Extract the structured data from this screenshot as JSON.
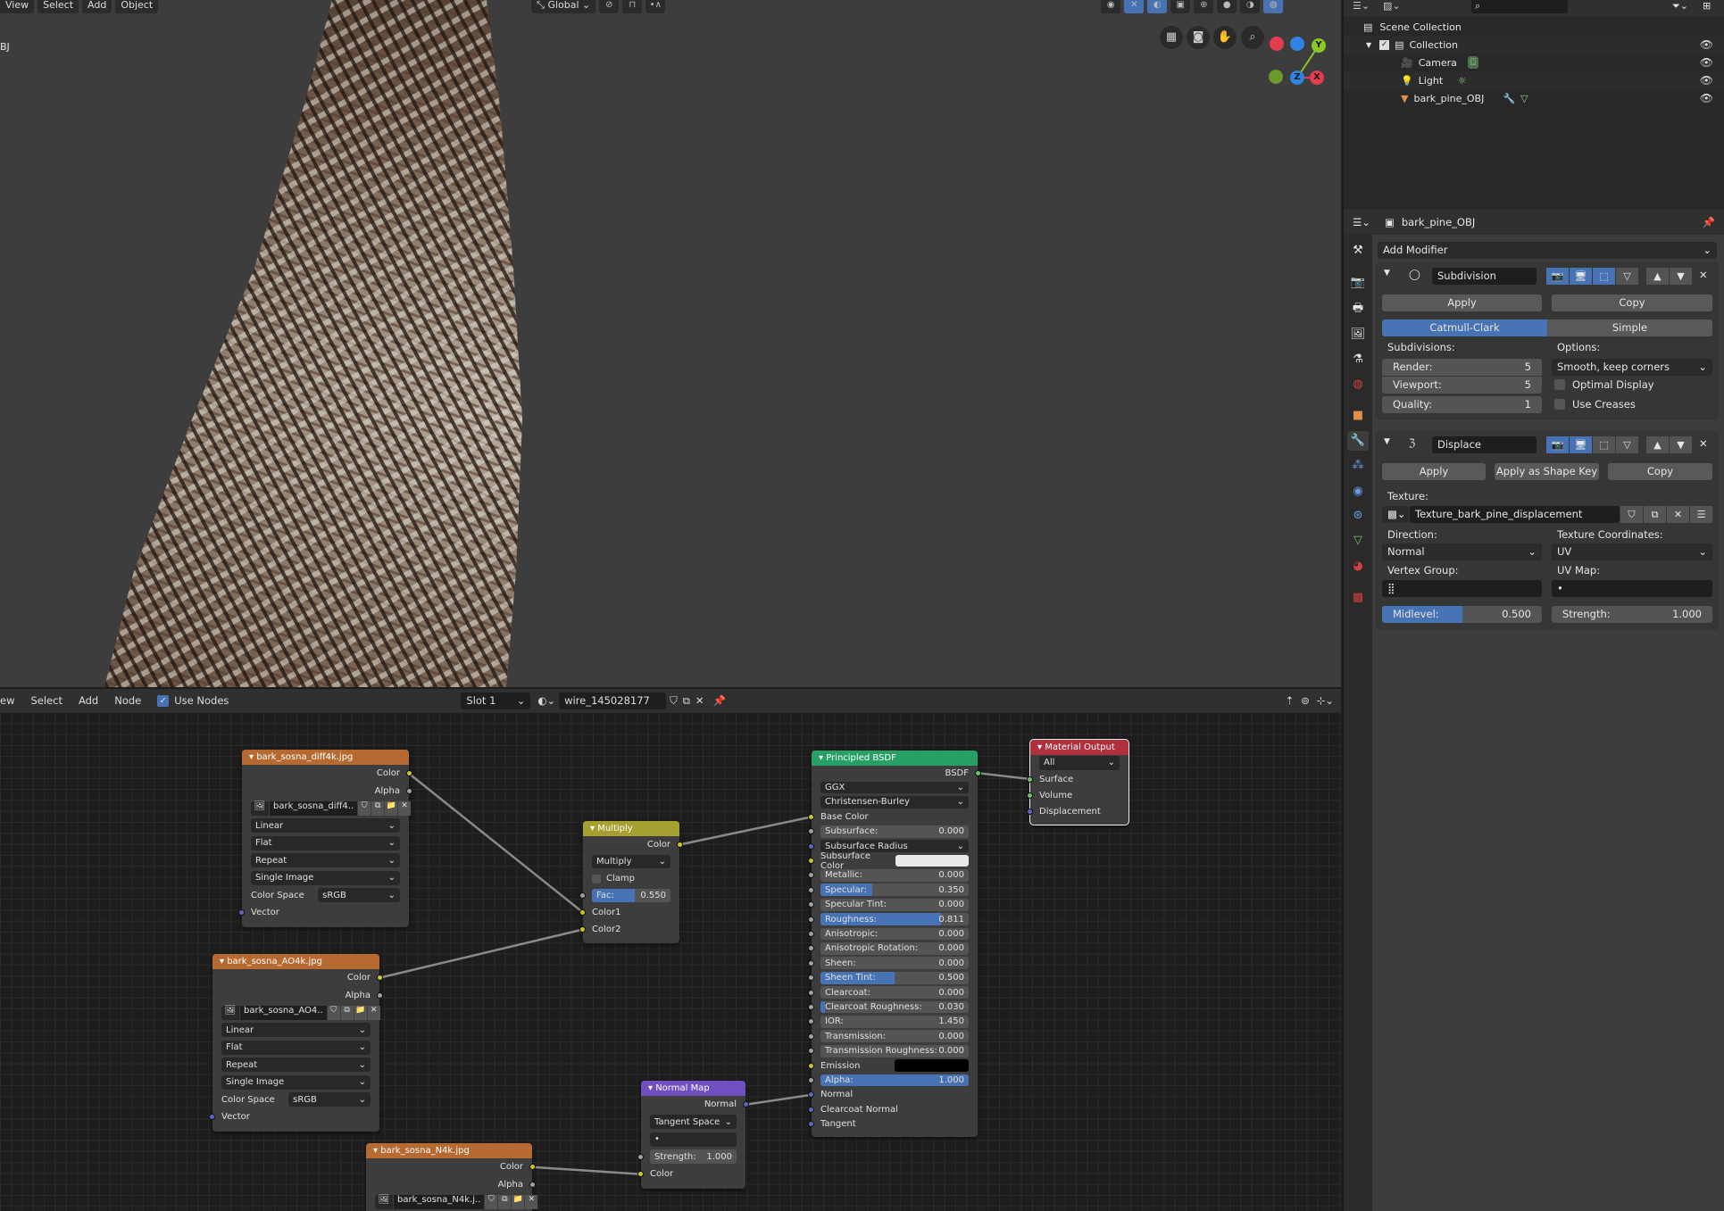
{
  "viewport": {
    "menus": [
      "View",
      "Select",
      "Add",
      "Object"
    ],
    "orientation": "Global",
    "object_label_fragment": "BJ",
    "nav_icons": [
      "grid-icon",
      "camera-icon",
      "hand-icon",
      "zoom-icon"
    ],
    "axes": {
      "x": "X",
      "y": "Y",
      "z": "Z"
    },
    "colors": {
      "x": "#e53d4f",
      "y": "#8bc727",
      "z": "#2f83e3"
    }
  },
  "node_editor": {
    "menus": [
      "ew",
      "Select",
      "Add",
      "Node"
    ],
    "use_nodes_label": "Use Nodes",
    "use_nodes": true,
    "slot": "Slot 1",
    "material": "wire_145028177"
  },
  "nodes": [
    {
      "id": "diff",
      "title": "bark_sosna_diff4k.jpg",
      "color": "#b66a32",
      "rows": [
        {
          "k": "out",
          "label": "Color",
          "sock": "#c7c729"
        },
        {
          "k": "out",
          "label": "Alpha",
          "sock": "#a1a1a1"
        },
        {
          "k": "img",
          "label": "bark_sosna_diff4.."
        },
        {
          "k": "select",
          "label": "Linear"
        },
        {
          "k": "select",
          "label": "Flat"
        },
        {
          "k": "select",
          "label": "Repeat"
        },
        {
          "k": "select",
          "label": "Single Image"
        },
        {
          "k": "lselect",
          "label": "Color Space",
          "value": "sRGB"
        },
        {
          "k": "in",
          "label": "Vector",
          "sock": "#6363c7"
        }
      ]
    },
    {
      "id": "ao",
      "title": "bark_sosna_AO4k.jpg",
      "color": "#b66a32",
      "rows": [
        {
          "k": "out",
          "label": "Color",
          "sock": "#c7c729"
        },
        {
          "k": "out",
          "label": "Alpha",
          "sock": "#a1a1a1"
        },
        {
          "k": "img",
          "label": "bark_sosna_AO4.."
        },
        {
          "k": "select",
          "label": "Linear"
        },
        {
          "k": "select",
          "label": "Flat"
        },
        {
          "k": "select",
          "label": "Repeat"
        },
        {
          "k": "select",
          "label": "Single Image"
        },
        {
          "k": "lselect",
          "label": "Color Space",
          "value": "sRGB"
        },
        {
          "k": "in",
          "label": "Vector",
          "sock": "#6363c7"
        }
      ]
    },
    {
      "id": "nrm",
      "title": "bark_sosna_N4k.jpg",
      "color": "#b66a32",
      "rows": [
        {
          "k": "out",
          "label": "Color",
          "sock": "#c7c729"
        },
        {
          "k": "out",
          "label": "Alpha",
          "sock": "#a1a1a1"
        },
        {
          "k": "img",
          "label": "bark_sosna_N4k.j.."
        }
      ]
    },
    {
      "id": "mix",
      "title": "Multiply",
      "color": "#a6a030",
      "rows": [
        {
          "k": "out",
          "label": "Color",
          "sock": "#c7c729"
        },
        {
          "k": "select",
          "label": "Multiply"
        },
        {
          "k": "check",
          "label": "Clamp"
        },
        {
          "k": "slider",
          "label": "Fac:",
          "value": "0.550",
          "fill": 0.55,
          "sock": "#a1a1a1"
        },
        {
          "k": "in",
          "label": "Color1",
          "sock": "#c7c729"
        },
        {
          "k": "in",
          "label": "Color2",
          "sock": "#c7c729"
        }
      ]
    },
    {
      "id": "nmap",
      "title": "Normal Map",
      "color": "#7050c0",
      "rows": [
        {
          "k": "out",
          "label": "Normal",
          "sock": "#6363c7"
        },
        {
          "k": "select",
          "label": "Tangent Space"
        },
        {
          "k": "field",
          "label": "•"
        },
        {
          "k": "slider",
          "label": "Strength:",
          "value": "1.000",
          "fill": 0,
          "sock": "#a1a1a1"
        },
        {
          "k": "in",
          "label": "Color",
          "sock": "#c7c729"
        }
      ]
    },
    {
      "id": "bsdf",
      "title": "Principled BSDF",
      "color": "#27a065",
      "rows": [
        {
          "k": "out",
          "label": "BSDF",
          "sock": "#63c763"
        },
        {
          "k": "select",
          "label": "GGX"
        },
        {
          "k": "select",
          "label": "Christensen-Burley"
        },
        {
          "k": "in",
          "label": "Base Color",
          "sock": "#c7c729"
        },
        {
          "k": "slider",
          "label": "Subsurface:",
          "value": "0.000",
          "fill": 0,
          "sock": "#a1a1a1"
        },
        {
          "k": "select",
          "label": "Subsurface Radius",
          "sock": "#6363c7"
        },
        {
          "k": "color",
          "label": "Subsurface Color",
          "swatch": "#e8e8e8",
          "sock": "#c7c729"
        },
        {
          "k": "slider",
          "label": "Metallic:",
          "value": "0.000",
          "fill": 0,
          "sock": "#a1a1a1"
        },
        {
          "k": "slider",
          "label": "Specular:",
          "value": "0.350",
          "fill": 0.35,
          "sock": "#a1a1a1"
        },
        {
          "k": "slider",
          "label": "Specular Tint:",
          "value": "0.000",
          "fill": 0,
          "sock": "#a1a1a1"
        },
        {
          "k": "slider",
          "label": "Roughness:",
          "value": "0.811",
          "fill": 0.811,
          "sock": "#a1a1a1"
        },
        {
          "k": "slider",
          "label": "Anisotropic:",
          "value": "0.000",
          "fill": 0,
          "sock": "#a1a1a1"
        },
        {
          "k": "slider",
          "label": "Anisotropic Rotation:",
          "value": "0.000",
          "fill": 0,
          "sock": "#a1a1a1"
        },
        {
          "k": "slider",
          "label": "Sheen:",
          "value": "0.000",
          "fill": 0,
          "sock": "#a1a1a1"
        },
        {
          "k": "slider",
          "label": "Sheen Tint:",
          "value": "0.500",
          "fill": 0.5,
          "sock": "#a1a1a1"
        },
        {
          "k": "slider",
          "label": "Clearcoat:",
          "value": "0.000",
          "fill": 0,
          "sock": "#a1a1a1"
        },
        {
          "k": "slider",
          "label": "Clearcoat Roughness:",
          "value": "0.030",
          "fill": 0.03,
          "sock": "#a1a1a1"
        },
        {
          "k": "slider",
          "label": "IOR:",
          "value": "1.450",
          "fill": 0,
          "sock": "#a1a1a1"
        },
        {
          "k": "slider",
          "label": "Transmission:",
          "value": "0.000",
          "fill": 0,
          "sock": "#a1a1a1"
        },
        {
          "k": "slider",
          "label": "Transmission Roughness:",
          "value": "0.000",
          "fill": 0,
          "sock": "#a1a1a1"
        },
        {
          "k": "color",
          "label": "Emission",
          "swatch": "#000000",
          "sock": "#c7c729"
        },
        {
          "k": "slider",
          "label": "Alpha:",
          "value": "1.000",
          "fill": 1,
          "sock": "#a1a1a1"
        },
        {
          "k": "in",
          "label": "Normal",
          "sock": "#6363c7"
        },
        {
          "k": "in",
          "label": "Clearcoat Normal",
          "sock": "#6363c7"
        },
        {
          "k": "in",
          "label": "Tangent",
          "sock": "#6363c7"
        }
      ]
    },
    {
      "id": "out",
      "title": "Material Output",
      "color": "#b0303c",
      "selected": true,
      "rows": [
        {
          "k": "select",
          "label": "All"
        },
        {
          "k": "in",
          "label": "Surface",
          "sock": "#63c763"
        },
        {
          "k": "in",
          "label": "Volume",
          "sock": "#63c763"
        },
        {
          "k": "in",
          "label": "Displacement",
          "sock": "#6363c7"
        }
      ]
    }
  ],
  "links": [
    {
      "from": "diff.0",
      "to": "mix.4"
    },
    {
      "from": "ao.0",
      "to": "mix.5"
    },
    {
      "from": "mix.0",
      "to": "bsdf.3"
    },
    {
      "from": "nrm.0",
      "to": "nmap.4"
    },
    {
      "from": "nmap.0",
      "to": "bsdf.22"
    },
    {
      "from": "bsdf.0",
      "to": "out.1"
    }
  ],
  "outliner": {
    "root": "Scene Collection",
    "items": [
      {
        "label": "Collection",
        "icon": "collection-icon"
      },
      {
        "label": "Camera",
        "icon": "camera-object-icon"
      },
      {
        "label": "Light",
        "icon": "light-object-icon"
      },
      {
        "label": "bark_pine_OBJ",
        "icon": "mesh-object-icon"
      }
    ]
  },
  "properties": {
    "object_name": "bark_pine_OBJ",
    "add_modifier": "Add Modifier",
    "subdivision": {
      "name": "Subdivision",
      "apply": "Apply",
      "copy": "Copy",
      "modes": [
        "Catmull-Clark",
        "Simple"
      ],
      "active_mode": "Catmull-Clark",
      "subdivisions_label": "Subdivisions:",
      "options_label": "Options:",
      "render_label": "Render:",
      "render": "5",
      "viewport_label": "Viewport:",
      "viewport": "5",
      "quality_label": "Quality:",
      "quality": "1",
      "uv_smooth": "Smooth, keep corners",
      "optimal_display": "Optimal Display",
      "use_creases": "Use Creases"
    },
    "displace": {
      "name": "Displace",
      "apply": "Apply",
      "apply_shape_key": "Apply as Shape Key",
      "copy": "Copy",
      "texture_label": "Texture:",
      "texture": "Texture_bark_pine_displacement",
      "direction_label": "Direction:",
      "direction": "Normal",
      "tex_coords_label": "Texture Coordinates:",
      "tex_coords": "UV",
      "vertex_group_label": "Vertex Group:",
      "uv_map_label": "UV Map:",
      "uv_map": "•",
      "midlevel_label": "Midlevel:",
      "midlevel": "0.500",
      "midlevel_fill": 0.5,
      "strength_label": "Strength:",
      "strength": "1.000"
    }
  }
}
